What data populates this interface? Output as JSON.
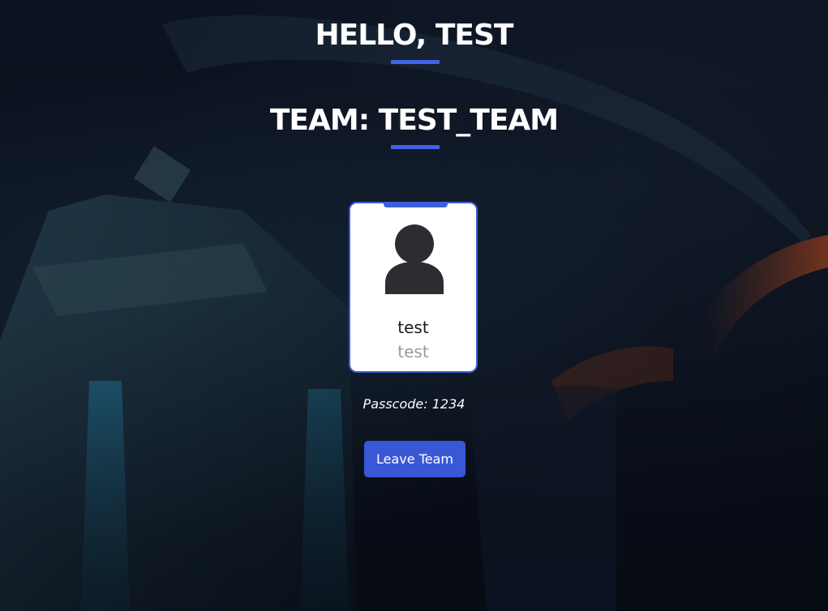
{
  "header": {
    "greeting": "HELLO, TEST",
    "team_title": "TEAM: TEST_TEAM"
  },
  "member_card": {
    "name": "test",
    "subtitle": "test",
    "avatar_icon": "user-icon"
  },
  "passcode_text": "Passcode: 1234",
  "leave_button_label": "Leave Team",
  "colors": {
    "accent": "#3f63e8",
    "button": "#3a57d6",
    "card_border": "#3d5fd9",
    "background": "#0a0f1a"
  }
}
